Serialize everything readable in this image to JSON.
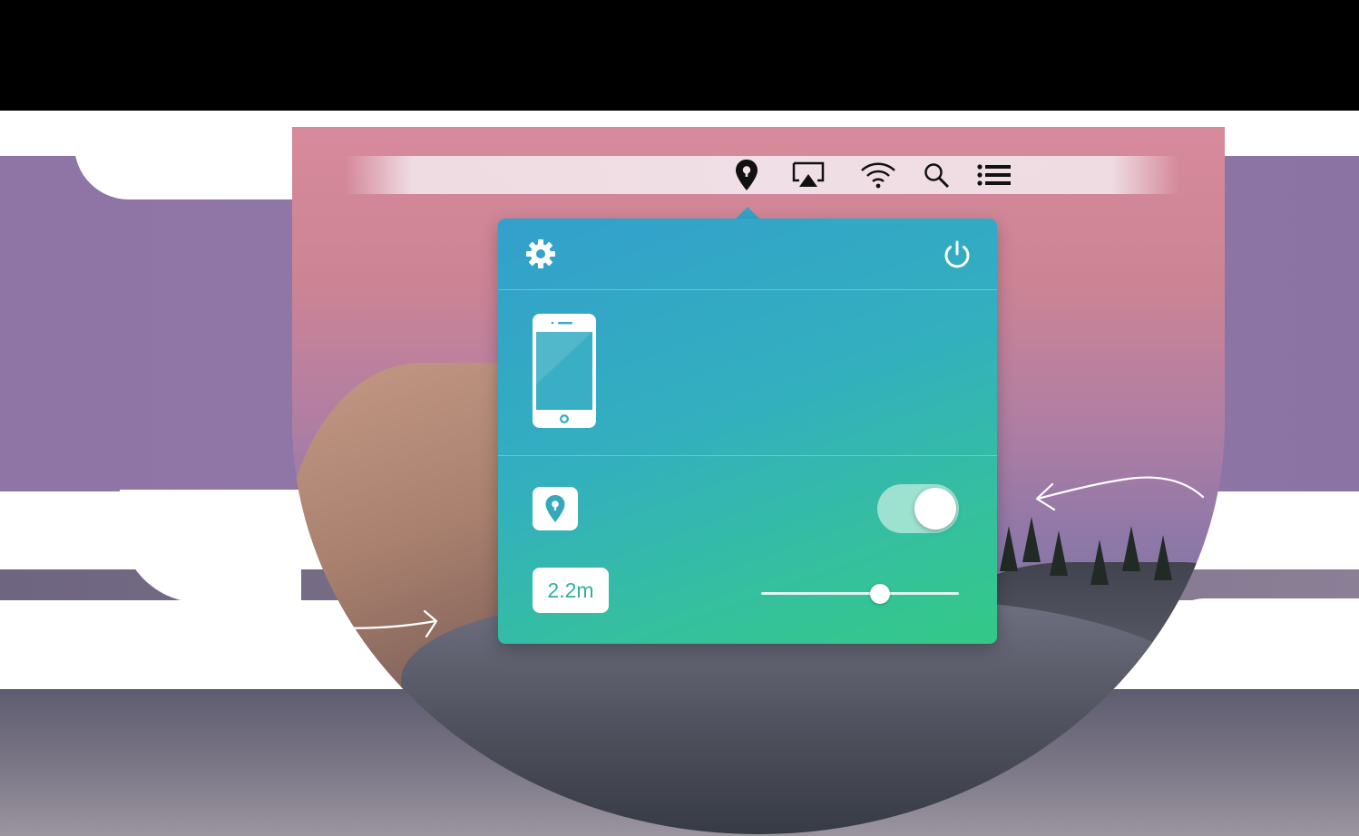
{
  "menubar": {
    "icons": [
      {
        "name": "location-pin-icon"
      },
      {
        "name": "airplay-icon"
      },
      {
        "name": "wifi-icon"
      },
      {
        "name": "spotlight-search-icon"
      },
      {
        "name": "notification-center-icon"
      }
    ]
  },
  "popover": {
    "settings_icon": "gear-icon",
    "power_icon": "power-icon",
    "device_icon": "iphone-icon",
    "proximity": {
      "icon": "location-pin-icon",
      "enabled": true,
      "distance_label": "2.2m",
      "slider_value": 0.6
    }
  },
  "colors": {
    "popover_gradient_start": "#33a0cc",
    "popover_gradient_end": "#33c987",
    "background_purple": "#8f75a6"
  }
}
